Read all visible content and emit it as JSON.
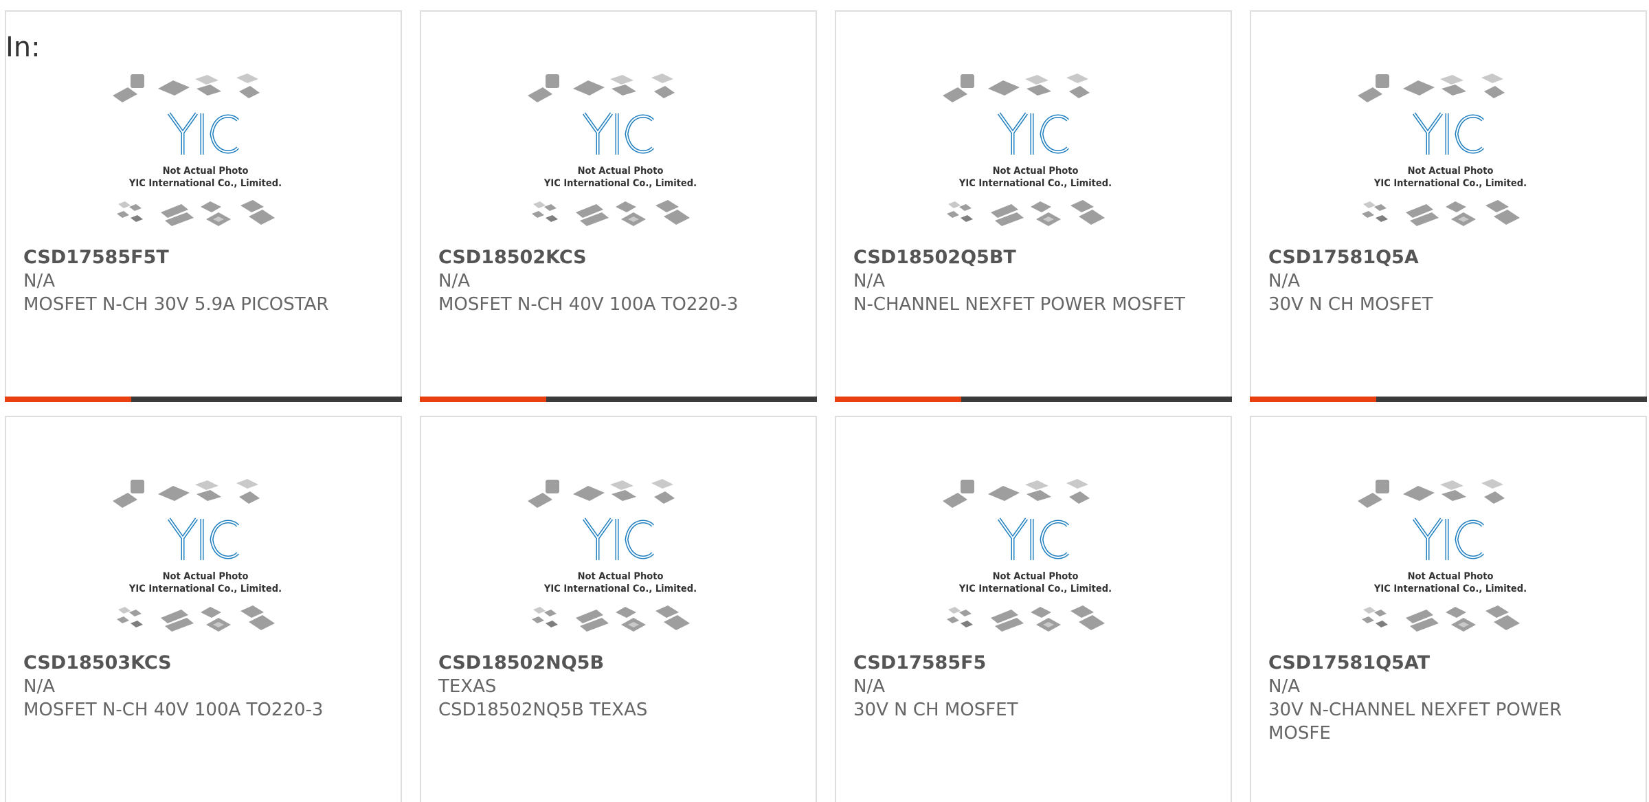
{
  "heading": "In:",
  "theme": {
    "accent": "#e8400f",
    "bar": "#3b3b3b",
    "logo_blue": "#1f7fc0"
  },
  "placeholder_image": {
    "line1": "Not Actual Photo",
    "line2": "YIC International Co., Limited.",
    "logo_icon": "yic-logo-icon",
    "chips_icon": "ic-packages-icon"
  },
  "products": [
    {
      "part_number": "CSD17585F5T",
      "manufacturer": "N/A",
      "description": "MOSFET N-CH 30V 5.9A PICOSTAR"
    },
    {
      "part_number": "CSD18502KCS",
      "manufacturer": "N/A",
      "description": "MOSFET N-CH 40V 100A TO220-3"
    },
    {
      "part_number": "CSD18502Q5BT",
      "manufacturer": "N/A",
      "description": "N-CHANNEL NEXFET POWER MOSFET"
    },
    {
      "part_number": "CSD17581Q5A",
      "manufacturer": "N/A",
      "description": "30V N CH MOSFET"
    },
    {
      "part_number": "CSD18503KCS",
      "manufacturer": "N/A",
      "description": "MOSFET N-CH 40V 100A TO220-3"
    },
    {
      "part_number": "CSD18502NQ5B",
      "manufacturer": "TEXAS",
      "description": "CSD18502NQ5B TEXAS"
    },
    {
      "part_number": "CSD17585F5",
      "manufacturer": "N/A",
      "description": "30V N CH MOSFET"
    },
    {
      "part_number": "CSD17581Q5AT",
      "manufacturer": "N/A",
      "description": "30V N-CHANNEL NEXFET POWER MOSFE"
    }
  ]
}
